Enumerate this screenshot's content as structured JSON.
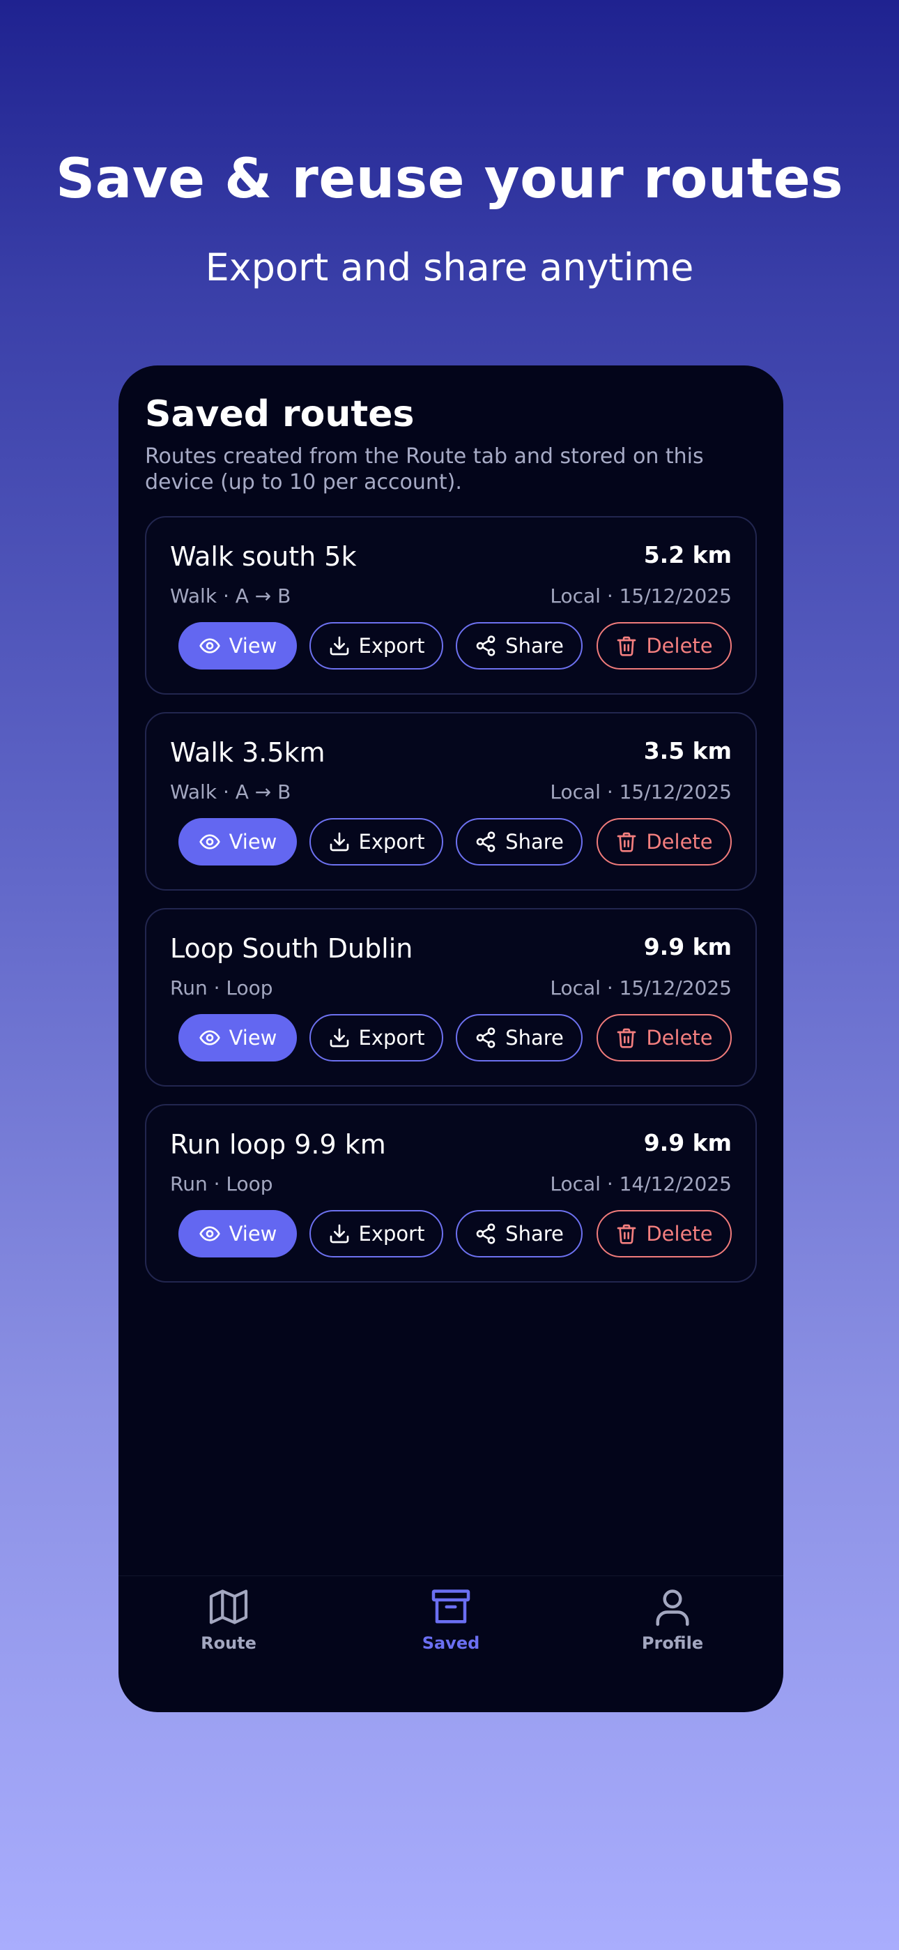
{
  "promo": {
    "headline": "Save & reuse your routes",
    "subheadline": "Export and share anytime"
  },
  "screen": {
    "title": "Saved routes",
    "description": "Routes created from the Route tab and stored on this device (up to 10 per account)."
  },
  "actions": {
    "view": "View",
    "export": "Export",
    "share": "Share",
    "delete": "Delete"
  },
  "routes": [
    {
      "name": "Walk south 5k",
      "distance": "5.2 km",
      "type": "Walk · A → B",
      "meta": "Local · 15/12/2025"
    },
    {
      "name": "Walk 3.5km",
      "distance": "3.5 km",
      "type": "Walk · A → B",
      "meta": "Local · 15/12/2025"
    },
    {
      "name": "Loop South Dublin",
      "distance": "9.9 km",
      "type": "Run · Loop",
      "meta": "Local · 15/12/2025"
    },
    {
      "name": "Run loop 9.9 km",
      "distance": "9.9 km",
      "type": "Run · Loop",
      "meta": "Local · 14/12/2025"
    }
  ],
  "tabs": [
    {
      "label": "Route",
      "icon": "map-icon",
      "active": false
    },
    {
      "label": "Saved",
      "icon": "archive-icon",
      "active": true
    },
    {
      "label": "Profile",
      "icon": "user-icon",
      "active": false
    }
  ],
  "colors": {
    "accent": "#6367f1",
    "danger": "#f07b7b",
    "screen_bg": "#03051a",
    "muted_text": "#a3a7c0"
  }
}
